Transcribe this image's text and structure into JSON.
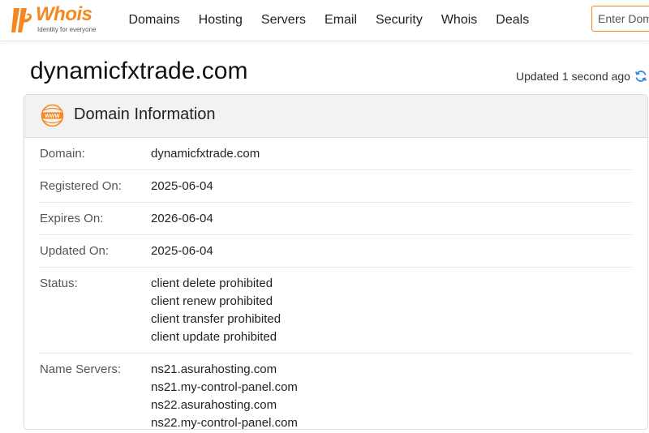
{
  "header": {
    "logo_text": "Whois",
    "logo_tagline": "Identity for everyone",
    "nav": [
      "Domains",
      "Hosting",
      "Servers",
      "Email",
      "Security",
      "Whois",
      "Deals"
    ],
    "search_placeholder": "Enter Domain"
  },
  "page": {
    "title": "dynamicfxtrade.com",
    "updated": "Updated 1 second ago"
  },
  "card": {
    "title": "Domain Information",
    "icon": "www-icon",
    "rows": [
      {
        "label": "Domain:",
        "values": [
          "dynamicfxtrade.com"
        ]
      },
      {
        "label": "Registered On:",
        "values": [
          "2025-06-04"
        ]
      },
      {
        "label": "Expires On:",
        "values": [
          "2026-06-04"
        ]
      },
      {
        "label": "Updated On:",
        "values": [
          "2025-06-04"
        ]
      },
      {
        "label": "Status:",
        "values": [
          "client delete prohibited",
          "client renew prohibited",
          "client transfer prohibited",
          "client update prohibited"
        ]
      },
      {
        "label": "Name Servers:",
        "values": [
          "ns21.asurahosting.com",
          "ns21.my-control-panel.com",
          "ns22.asurahosting.com",
          "ns22.my-control-panel.com"
        ]
      }
    ]
  },
  "colors": {
    "brand": "#f6871f",
    "refresh": "#2d8ae6"
  }
}
